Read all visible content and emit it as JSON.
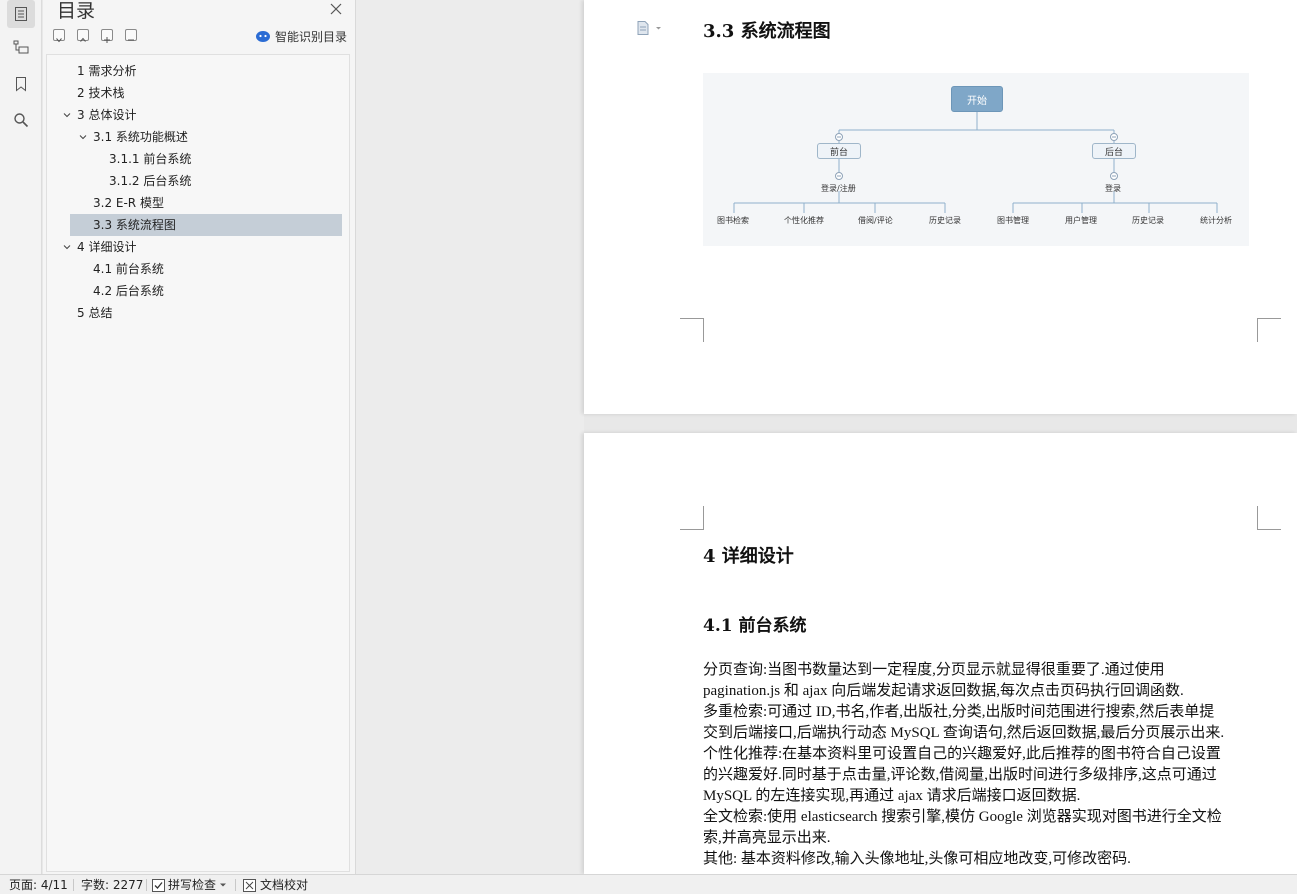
{
  "toc": {
    "title": "目录",
    "smart_label": "智能识别目录",
    "items": [
      {
        "text": "1  需求分析"
      },
      {
        "text": "2 技术栈"
      },
      {
        "text": "3  总体设计"
      },
      {
        "text": "3.1  系统功能概述"
      },
      {
        "text": "3.1.1  前台系统"
      },
      {
        "text": "3.1.2  后台系统"
      },
      {
        "text": "3.2 E-R 模型"
      },
      {
        "text": "3.3  系统流程图"
      },
      {
        "text": "4  详细设计"
      },
      {
        "text": "4.1  前台系统"
      },
      {
        "text": "4.2  后台系统"
      },
      {
        "text": "5  总结"
      }
    ]
  },
  "doc": {
    "heading_33": "3.3  系统流程图",
    "heading_4": "4  详细设计",
    "heading_41": "4.1  前台系统",
    "flow": {
      "start": "开始",
      "front": "前台",
      "back": "后台",
      "front_login": "登录/注册",
      "back_login": "登录",
      "front_leaves": [
        "图书检索",
        "个性化推荐",
        "借阅/评论",
        "历史记录"
      ],
      "back_leaves": [
        "图书管理",
        "用户管理",
        "历史记录",
        "统计分析"
      ]
    },
    "paragraphs": [
      "分页查询:当图书数量达到一定程度,分页显示就显得很重要了.通过使用",
      "pagination.js 和 ajax 向后端发起请求返回数据,每次点击页码执行回调函数.",
      "多重检索:可通过 ID,书名,作者,出版社,分类,出版时间范围进行搜索,然后表单提",
      "交到后端接口,后端执行动态 MySQL 查询语句,然后返回数据,最后分页展示出来.",
      "个性化推荐:在基本资料里可设置自己的兴趣爱好,此后推荐的图书符合自己设置",
      "的兴趣爱好.同时基于点击量,评论数,借阅量,出版时间进行多级排序,这点可通过",
      "MySQL 的左连接实现,再通过 ajax 请求后端接口返回数据.",
      "全文检索:使用 elasticsearch 搜索引擎,模仿 Google 浏览器实现对图书进行全文检",
      "索,并高亮显示出来.",
      "其他:  基本资料修改,输入头像地址,头像可相应地改变,可修改密码."
    ]
  },
  "status": {
    "page": "页面: 4/11",
    "words": "字数: 2277",
    "spell": "拼写检查",
    "proof": "文档校对"
  },
  "colors": {
    "accent": "#2b6cd4",
    "selected": "#c5ced7",
    "flow_start": "#7fa7c8"
  }
}
